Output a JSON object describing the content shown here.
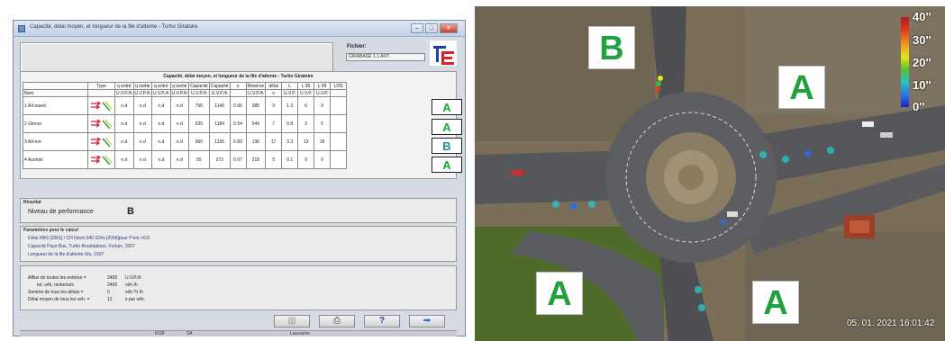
{
  "window": {
    "title": "Capacité, délai moyen, et longueur de la file d'attente - Turbo Giratoire",
    "fichier_label": "Fichier:",
    "fichier_value": "GIRABASE 1.1 ART."
  },
  "table": {
    "caption": "Capacité, délai moyen, et longueur de la file d'attente - Turbo Giratoire",
    "headers": [
      "Type",
      "q entré",
      "q sortie",
      "q entré",
      "q sortie",
      "Capacité",
      "Capacité",
      "x",
      "Réserve",
      "délai",
      "L",
      "L 95",
      "L 99",
      "LOS"
    ],
    "units": [
      "",
      "U.V.P./h",
      "U.V.P./h",
      "U.V.P./h",
      "U.V.P./h",
      "U.V.P./h",
      "U.V.P./h",
      "",
      "U.V.P./h",
      "s",
      "U.V.P.",
      "U.V.P.",
      "U.V.P.",
      ""
    ],
    "name_header": "Nom",
    "rows": [
      {
        "name": "1 Aït-ouest",
        "a": "n.d",
        "b": "n.d",
        "c": "n.d",
        "d": "n.d",
        "cap": "755",
        "cap2": "1140",
        "x": "0.66",
        "res": "385",
        "delai": "9",
        "l": "1.3",
        "l95": "6",
        "l99": "9",
        "los": "A"
      },
      {
        "name": "2 Glenor",
        "a": "n.d",
        "b": "n.d",
        "c": "n.d",
        "d": "n.d",
        "cap": "635",
        "cap2": "1184",
        "x": "0.54",
        "res": "549",
        "delai": "7",
        "l": "0.8",
        "l95": "3",
        "l99": "5",
        "los": "A"
      },
      {
        "name": "3 Aït-est",
        "a": "n.d",
        "b": "n.d",
        "c": "n.d",
        "d": "n.d",
        "cap": "960",
        "cap2": "1156",
        "x": "0.83",
        "res": "196",
        "delai": "17",
        "l": "3.3",
        "l95": "13",
        "l99": "18",
        "los": "B"
      },
      {
        "name": "4 Auxtriel",
        "a": "n.d",
        "b": "n.d",
        "c": "n.d",
        "d": "n.d",
        "cap": "55",
        "cap2": "273",
        "x": "0.67",
        "res": "218",
        "delai": "5",
        "l": "0.1",
        "l95": "0",
        "l99": "0",
        "los": "A"
      }
    ]
  },
  "result": {
    "title": "Résultat",
    "label": "Niveau de performance",
    "value": "B"
  },
  "parameters": {
    "title": "Paramètres pour le calcul",
    "line1": "Délai                    HBS [2001] / CH Norm 640 024a [2006]pour  P'ent >0.8",
    "line2": "Capacité    Pays-Bas, Turbo Roundabout, Fortuin, 2007",
    "line3": "Longueur de la file d'attente  Wu, 1997"
  },
  "flows": [
    {
      "label": "Afflux de toutes les entrées =",
      "value": "2405",
      "unit": "U.V.P./h"
    },
    {
      "label": "tot. véh. motorisés",
      "value": "2405",
      "unit": "véh./h"
    },
    {
      "label": "Somme de tous les délais =",
      "value": "0",
      "unit": "véh.*h /h"
    },
    {
      "label": "Délai moyen de tous les véh. =",
      "value": "12",
      "unit": "s par véh."
    }
  ],
  "toolbar": {
    "print_icon": "printer-icon",
    "help_label": "?",
    "next_icon": "arrow-right-icon"
  },
  "status": {
    "left": "KGB",
    "mid": "SA",
    "right": "Lausanne"
  },
  "aerial": {
    "badges": [
      {
        "id": "nw",
        "label": "B"
      },
      {
        "id": "ne",
        "label": "A"
      },
      {
        "id": "sw",
        "label": "A"
      },
      {
        "id": "se",
        "label": "A"
      }
    ],
    "colorbar_labels": [
      "40''",
      "30''",
      "20''",
      "10''",
      "0''"
    ],
    "timestamp": "05. 01. 2021 16:01:42"
  }
}
